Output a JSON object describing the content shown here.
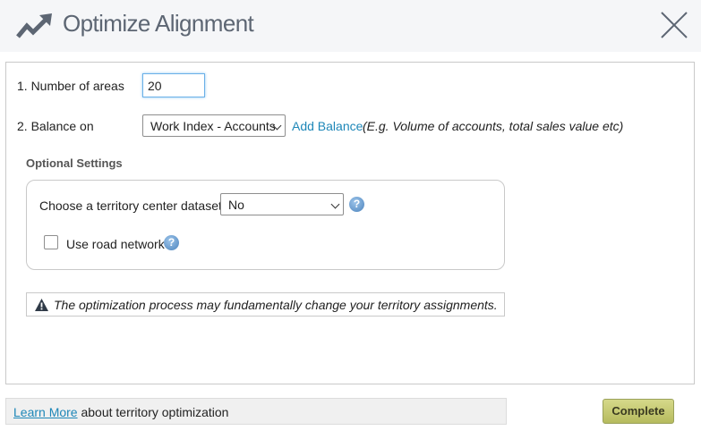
{
  "header": {
    "title": "Optimize Alignment",
    "icon": "trending-up-icon",
    "close_icon": "close-icon"
  },
  "form": {
    "areas_label": "1. Number of areas",
    "areas_value": "20",
    "balance_label": "2. Balance on",
    "balance_selected": "Work Index - Accounts",
    "add_balance_link": "Add Balance",
    "balance_hint": "(E.g. Volume of accounts, total sales value etc)"
  },
  "optional": {
    "title": "Optional Settings",
    "center_label": "Choose a territory center dataset?",
    "center_selected": "No",
    "road_label": "Use road network",
    "road_checked": false,
    "help_glyph": "?"
  },
  "warning": {
    "text": "The optimization process may fundamentally change your territory assignments."
  },
  "footer": {
    "learn_more_link": "Learn More",
    "learn_more_text": " about territory optimization",
    "complete_button": "Complete"
  },
  "colors": {
    "accent_link": "#1e87b8",
    "title": "#5d6673",
    "complete_button": "#c6ca74"
  }
}
